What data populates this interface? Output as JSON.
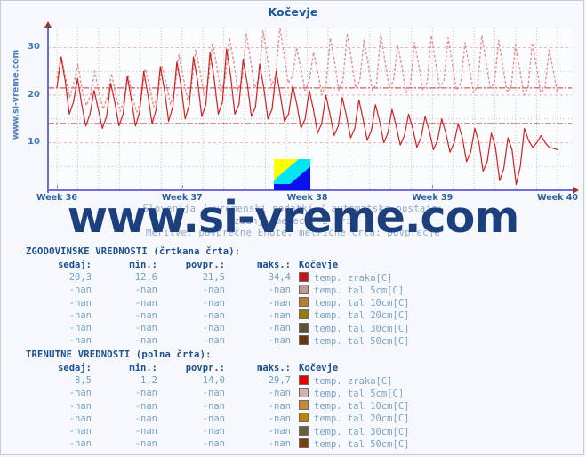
{
  "window": {
    "background": "#f6f8fc",
    "border_color": "#c9cbd4"
  },
  "header": {
    "title": "Kočevje",
    "title_color": "#15539e"
  },
  "side_label": {
    "text": "www.si-vreme.com",
    "color": "#4a7fc1"
  },
  "watermark": {
    "text": "www.si-vreme.com",
    "color": "#1c3f7e"
  },
  "subtitle": {
    "line1": "Slovenija / vremenski podatki / avtomatske postaje:",
    "line2": "zadnji mesec / 2 uri",
    "line3": "Meritve: povprečne  Enote: metrične  Črta: povprečje",
    "color": "#8fa9c9"
  },
  "chart_data": {
    "type": "line",
    "title": "Kočevje",
    "xlabel": "",
    "ylabel": "temp. zraka[C]",
    "ylim": [
      0,
      34
    ],
    "yticks": [
      10,
      20,
      30
    ],
    "xticks": [
      "Week 36",
      "Week 37",
      "Week 38",
      "Week 39",
      "Week 40"
    ],
    "grid": true,
    "legend_position": "below-table",
    "series": [
      {
        "name": "temp. zraka[C] - zgodovinske vrednosti",
        "style": "dashed",
        "color": "#e88f8f",
        "now": 20.3,
        "min": 12.6,
        "avg": 21.5,
        "max": 34.4,
        "average_line": 21.5,
        "values": [
          23.5,
          28.2,
          24.0,
          19.5,
          22.4,
          26.5,
          21.0,
          17.8,
          20.0,
          25.0,
          20.5,
          17.0,
          19.6,
          24.5,
          20.0,
          16.5,
          19.0,
          24.0,
          19.5,
          16.4,
          19.0,
          25.5,
          22.0,
          17.5,
          20.0,
          26.0,
          22.5,
          18.0,
          21.0,
          28.5,
          24.0,
          19.0,
          22.0,
          29.5,
          25.0,
          20.0,
          23.0,
          31.0,
          26.0,
          20.5,
          23.5,
          32.0,
          27.0,
          21.0,
          23.0,
          33.0,
          27.5,
          21.5,
          23.5,
          33.5,
          28.0,
          22.0,
          24.0,
          34.4,
          28.5,
          22.5,
          24.0,
          30.0,
          25.5,
          21.0,
          23.0,
          29.0,
          25.0,
          20.0,
          22.5,
          32.0,
          27.0,
          21.0,
          23.0,
          33.0,
          27.5,
          21.5,
          23.0,
          31.5,
          26.5,
          21.0,
          22.5,
          33.0,
          27.0,
          21.5,
          23.0,
          30.5,
          26.0,
          20.5,
          22.0,
          31.0,
          26.5,
          21.0,
          22.5,
          32.5,
          27.0,
          21.5,
          23.0,
          32.0,
          26.5,
          21.0,
          22.5,
          31.0,
          26.0,
          20.5,
          22.0,
          32.5,
          27.0,
          21.5,
          22.5,
          31.5,
          26.0,
          20.5,
          22.0,
          30.5,
          25.5,
          20.0,
          21.5,
          31.0,
          26.0,
          20.5,
          21.5,
          29.5,
          25.0,
          20.3
        ]
      },
      {
        "name": "temp. zraka[C] - trenutne vrednosti",
        "style": "solid",
        "color": "#d21f1f",
        "now": 8.5,
        "min": 1.2,
        "avg": 14.0,
        "max": 29.7,
        "average_line": 14.0,
        "values": [
          21.5,
          28.0,
          23.0,
          16.0,
          18.5,
          23.5,
          18.0,
          13.5,
          16.0,
          21.0,
          17.0,
          13.0,
          15.5,
          22.5,
          18.5,
          13.5,
          16.0,
          24.0,
          19.0,
          13.5,
          16.5,
          25.0,
          20.0,
          14.0,
          17.0,
          26.0,
          21.0,
          14.5,
          17.5,
          27.0,
          22.0,
          15.0,
          18.0,
          28.0,
          23.0,
          15.5,
          18.0,
          29.0,
          23.5,
          16.0,
          18.5,
          29.7,
          24.0,
          16.0,
          18.0,
          27.5,
          22.5,
          15.5,
          17.5,
          26.5,
          21.5,
          15.0,
          17.0,
          25.0,
          20.0,
          14.5,
          16.0,
          22.0,
          18.0,
          13.0,
          15.0,
          21.0,
          17.0,
          12.0,
          14.0,
          20.0,
          16.0,
          11.5,
          13.5,
          19.5,
          15.5,
          11.0,
          13.0,
          19.0,
          15.0,
          10.5,
          12.5,
          18.0,
          14.5,
          10.0,
          12.0,
          17.0,
          13.5,
          9.5,
          11.5,
          16.0,
          13.0,
          9.0,
          11.0,
          15.5,
          12.5,
          8.5,
          10.5,
          15.0,
          12.0,
          8.0,
          10.0,
          14.0,
          11.0,
          6.0,
          8.0,
          13.0,
          10.0,
          4.0,
          6.0,
          12.0,
          9.0,
          2.0,
          4.5,
          11.0,
          8.5,
          1.2,
          5.0,
          13.0,
          10.5,
          9.0,
          10.0,
          11.5,
          10.0,
          9.0,
          8.8,
          8.5
        ]
      }
    ]
  },
  "logo": {
    "name": "si-vreme-logo",
    "colors": [
      "#ffff00",
      "#00e5f0",
      "#0a11ee"
    ]
  },
  "tables": [
    {
      "id": "historical",
      "title": "ZGODOVINSKE VREDNOSTI (črtkana črta):",
      "headers": [
        "sedaj:",
        "min.:",
        "povpr.:",
        "maks.:",
        "Kočevje"
      ],
      "rows": [
        {
          "sedaj": "20,3",
          "min": "12,6",
          "povpr": "21,5",
          "maks": "34,4",
          "swatch": "#cc1111",
          "label": "temp. zraka[C]"
        },
        {
          "sedaj": "-nan",
          "min": "-nan",
          "povpr": "-nan",
          "maks": "-nan",
          "swatch": "#c19a95",
          "label": "temp. tal  5cm[C]"
        },
        {
          "sedaj": "-nan",
          "min": "-nan",
          "povpr": "-nan",
          "maks": "-nan",
          "swatch": "#b5822c",
          "label": "temp. tal 10cm[C]"
        },
        {
          "sedaj": "-nan",
          "min": "-nan",
          "povpr": "-nan",
          "maks": "-nan",
          "swatch": "#9d7709",
          "label": "temp. tal 20cm[C]"
        },
        {
          "sedaj": "-nan",
          "min": "-nan",
          "povpr": "-nan",
          "maks": "-nan",
          "swatch": "#5c5130",
          "label": "temp. tal 30cm[C]"
        },
        {
          "sedaj": "-nan",
          "min": "-nan",
          "povpr": "-nan",
          "maks": "-nan",
          "swatch": "#67350e",
          "label": "temp. tal 50cm[C]"
        }
      ]
    },
    {
      "id": "current",
      "title": "TRENUTNE VREDNOSTI (polna črta):",
      "headers": [
        "sedaj:",
        "min.:",
        "povpr.:",
        "maks.:",
        "Kočevje"
      ],
      "rows": [
        {
          "sedaj": "8,5",
          "min": "1,2",
          "povpr": "14,0",
          "maks": "29,7",
          "swatch": "#e60000",
          "label": "temp. zraka[C]"
        },
        {
          "sedaj": "-nan",
          "min": "-nan",
          "povpr": "-nan",
          "maks": "-nan",
          "swatch": "#d3b3ad",
          "label": "temp. tal  5cm[C]"
        },
        {
          "sedaj": "-nan",
          "min": "-nan",
          "povpr": "-nan",
          "maks": "-nan",
          "swatch": "#c68b38",
          "label": "temp. tal 10cm[C]"
        },
        {
          "sedaj": "-nan",
          "min": "-nan",
          "povpr": "-nan",
          "maks": "-nan",
          "swatch": "#b8860b",
          "label": "temp. tal 20cm[C]"
        },
        {
          "sedaj": "-nan",
          "min": "-nan",
          "povpr": "-nan",
          "maks": "-nan",
          "swatch": "#66603c",
          "label": "temp. tal 30cm[C]"
        },
        {
          "sedaj": "-nan",
          "min": "-nan",
          "povpr": "-nan",
          "maks": "-nan",
          "swatch": "#7b3f0a",
          "label": "temp. tal 50cm[C]"
        }
      ]
    }
  ]
}
